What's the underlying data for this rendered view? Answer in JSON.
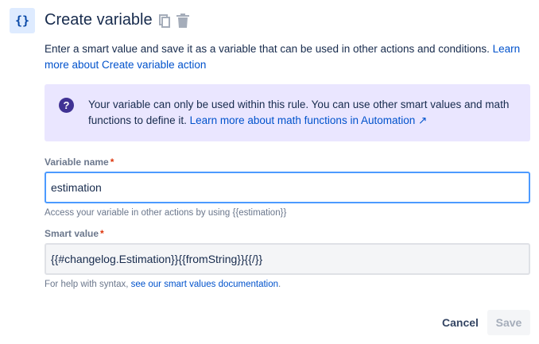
{
  "header": {
    "icon_text": "{}",
    "title": "Create variable"
  },
  "description": {
    "text": "Enter a smart value and save it as a variable that can be used in other actions and conditions. ",
    "link": "Learn more about Create variable action"
  },
  "info": {
    "text": "Your variable can only be used within this rule. You can use other smart values and math functions to define it. ",
    "link": "Learn more about math functions in Automation ↗"
  },
  "variable_name": {
    "label": "Variable name",
    "required": "*",
    "value": "estimation",
    "help": "Access your variable in other actions by using {{estimation}}"
  },
  "smart_value": {
    "label": "Smart value",
    "required": "*",
    "value": "{{#changelog.Estimation}}{{fromString}}{{/}}",
    "help": "For help with syntax, ",
    "help_link": "see our smart values documentation",
    "help_end": "."
  },
  "actions": {
    "cancel": "Cancel",
    "save": "Save"
  }
}
